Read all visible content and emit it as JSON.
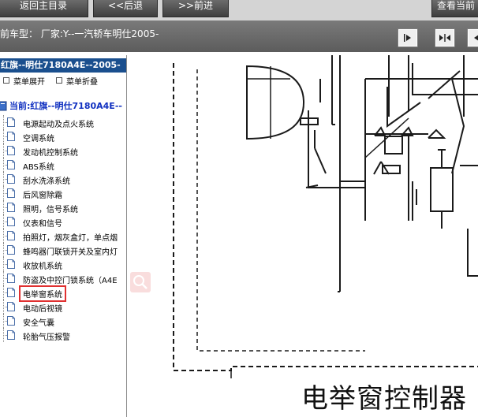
{
  "toolbar": {
    "back_to_home_label": "返回主目录",
    "back_label": "<<后退",
    "forward_label": ">>前进",
    "view_current_label": "查看当前"
  },
  "infobar": {
    "text": "前车型：  厂家:Y--一汽轿车明仕2005-"
  },
  "left_panel": {
    "title": "红旗--明仕7180A4E--2005-",
    "expand_label": "菜单展开",
    "collapse_label": "菜单折叠",
    "tree_root": "当前:红旗--明仕7180A4E--",
    "items": [
      {
        "label": "电源起动及点火系统"
      },
      {
        "label": "空调系统"
      },
      {
        "label": "发动机控制系统"
      },
      {
        "label": "ABS系统"
      },
      {
        "label": "刮水洗涤系统"
      },
      {
        "label": "后风窗除霜"
      },
      {
        "label": "照明，信号系统"
      },
      {
        "label": "仪表和信号"
      },
      {
        "label": "拍照灯，烟灰盒灯，单点烟"
      },
      {
        "label": "蜂鸣器门联锁开关及室内灯"
      },
      {
        "label": "收放机系统"
      },
      {
        "label": "防盗及中控门锁系统（A4E"
      },
      {
        "label": "电举窗系统"
      },
      {
        "label": "电动后视镜"
      },
      {
        "label": "安全气囊"
      },
      {
        "label": "轮胎气压报警"
      }
    ],
    "selected_index": 12
  },
  "diagram": {
    "caption": "电举窗控制器"
  },
  "colors": {
    "title_bar": "#1a4f8e",
    "selection_outline": "#e03030",
    "tree_root_text": "#1030c0"
  }
}
